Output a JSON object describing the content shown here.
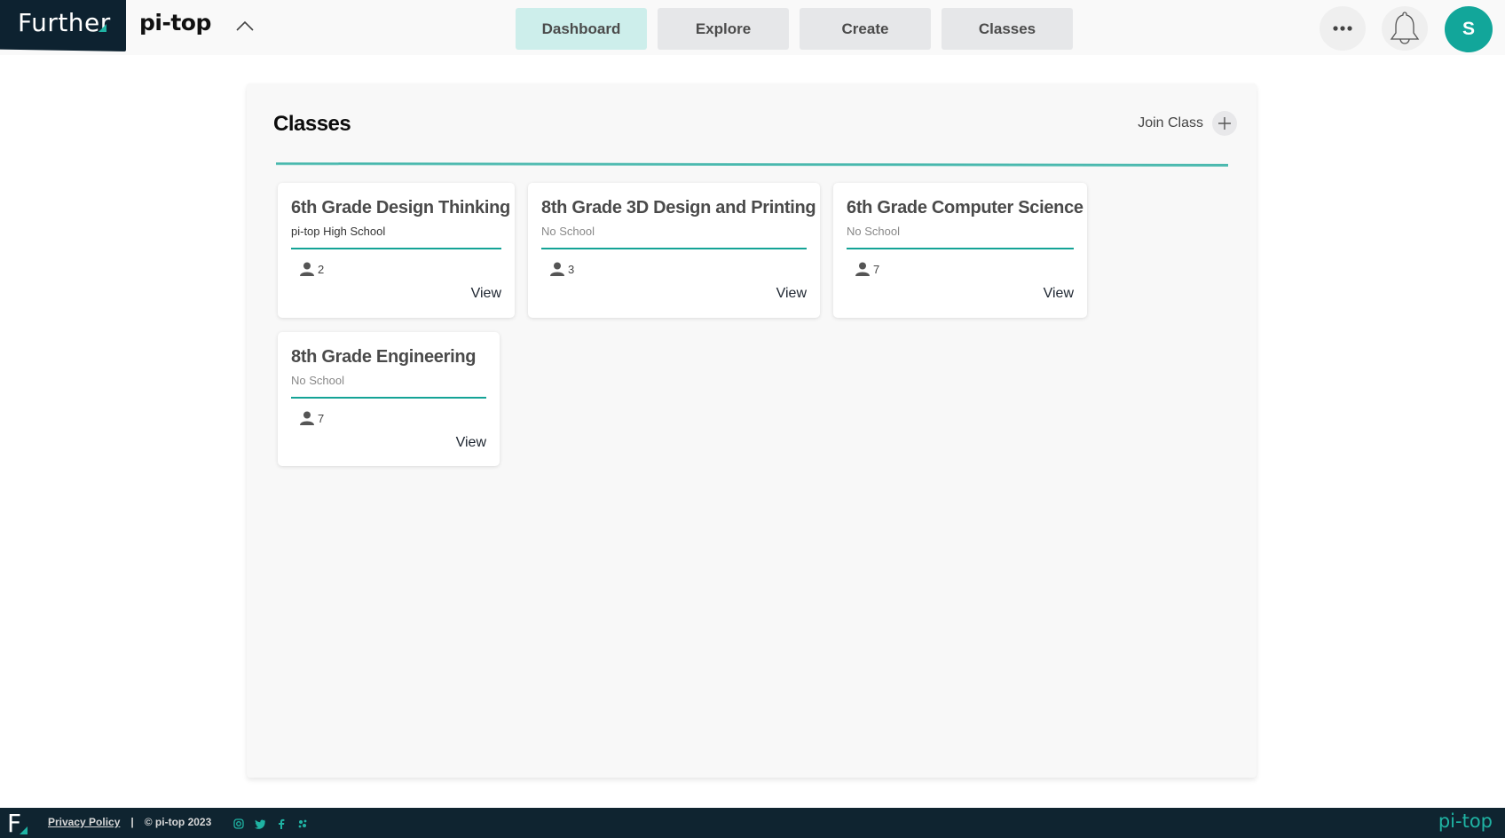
{
  "header": {
    "brand": "Further",
    "org_name": "pi-top",
    "nav": [
      {
        "label": "Dashboard",
        "active": true
      },
      {
        "label": "Explore",
        "active": false
      },
      {
        "label": "Create",
        "active": false
      },
      {
        "label": "Classes",
        "active": false
      }
    ],
    "more_icon": "more-horizontal-icon",
    "notifications_icon": "bell-icon",
    "avatar_initial": "S"
  },
  "panel": {
    "title": "Classes",
    "join_label": "Join Class"
  },
  "classes": [
    {
      "name": "6th Grade Design Thinking",
      "school": "pi-top High School",
      "members": "2",
      "action": "View"
    },
    {
      "name": "8th Grade 3D Design and Printing",
      "school": "No School",
      "members": "3",
      "action": "View"
    },
    {
      "name": "6th Grade Computer Science",
      "school": "No School",
      "members": "7",
      "action": "View"
    },
    {
      "name": "8th Grade Engineering",
      "school": "No School",
      "members": "7",
      "action": "View"
    }
  ],
  "footer": {
    "logo": "F",
    "privacy": "Privacy Policy",
    "separator": "|",
    "copyright": "© pi-top 2023",
    "social": [
      "instagram-icon",
      "twitter-icon",
      "facebook-icon",
      "pitop-icon"
    ],
    "brand": "pi-top"
  },
  "colors": {
    "accent": "#14a396",
    "dark": "#0f2430",
    "active_nav": "#cdeeeb"
  }
}
